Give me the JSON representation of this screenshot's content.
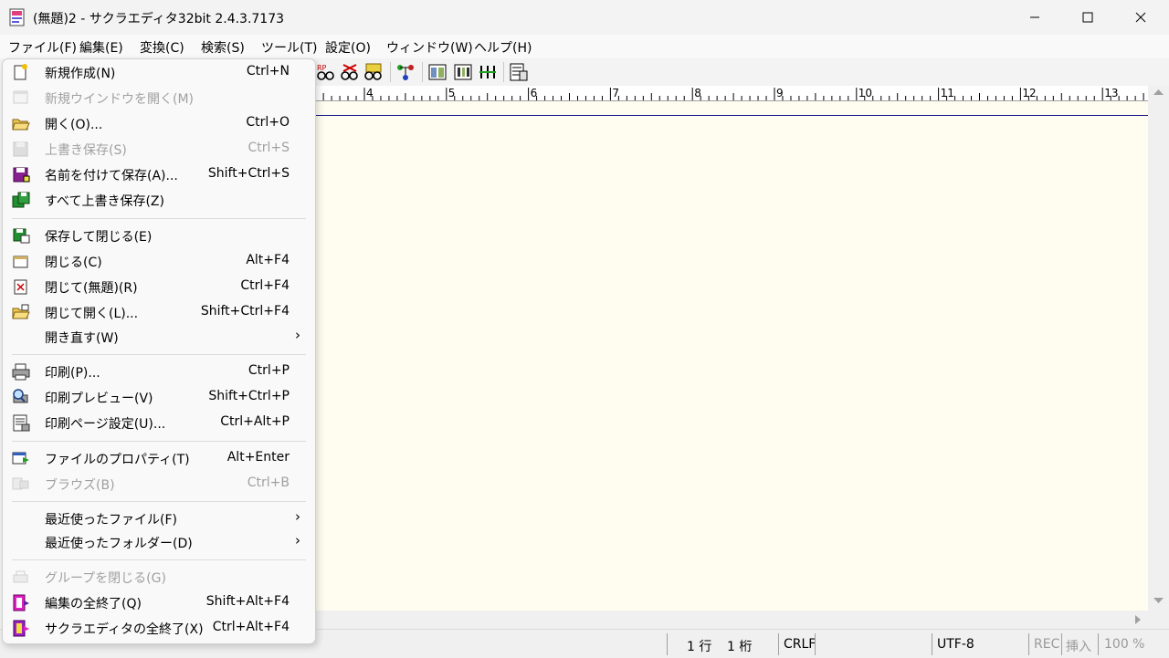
{
  "window": {
    "title": "(無題)2 - サクラエディタ32bit 2.4.3.7173"
  },
  "menubar": {
    "items": [
      "ファイル(F)",
      "編集(E)",
      "変換(C)",
      "検索(S)",
      "ツール(T)",
      "設定(O)",
      "ウィンドウ(W)",
      "ヘルプ(H)"
    ]
  },
  "ruler": {
    "labels": [
      "4",
      "5",
      "6",
      "7",
      "8",
      "9",
      "10",
      "11",
      "12",
      "13"
    ]
  },
  "file_menu": {
    "items": [
      {
        "label": "新規作成(N)",
        "shortcut": "Ctrl+N",
        "icon": "new-document-icon"
      },
      {
        "label": "新規ウインドウを開く(M)",
        "shortcut": "",
        "icon": "new-window-icon",
        "disabled": true
      },
      {
        "label": "開く(O)...",
        "shortcut": "Ctrl+O",
        "icon": "open-folder-icon"
      },
      {
        "label": "上書き保存(S)",
        "shortcut": "Ctrl+S",
        "icon": "save-icon",
        "disabled": true
      },
      {
        "label": "名前を付けて保存(A)...",
        "shortcut": "Shift+Ctrl+S",
        "icon": "save-as-icon"
      },
      {
        "label": "すべて上書き保存(Z)",
        "shortcut": "",
        "icon": "save-all-icon"
      },
      {
        "label": "保存して閉じる(E)",
        "shortcut": "",
        "icon": "save-close-icon"
      },
      {
        "label": "閉じる(C)",
        "shortcut": "Alt+F4",
        "icon": "close-document-icon"
      },
      {
        "label": "閉じて(無題)(R)",
        "shortcut": "Ctrl+F4",
        "icon": "close-untitled-icon"
      },
      {
        "label": "閉じて開く(L)...",
        "shortcut": "Shift+Ctrl+F4",
        "icon": "close-open-icon"
      },
      {
        "label": "開き直す(W)",
        "shortcut": "",
        "submenu": true
      },
      {
        "label": "印刷(P)...",
        "shortcut": "Ctrl+P",
        "icon": "print-icon"
      },
      {
        "label": "印刷プレビュー(V)",
        "shortcut": "Shift+Ctrl+P",
        "icon": "print-preview-icon"
      },
      {
        "label": "印刷ページ設定(U)...",
        "shortcut": "Ctrl+Alt+P",
        "icon": "page-setup-icon"
      },
      {
        "label": "ファイルのプロパティ(T)",
        "shortcut": "Alt+Enter",
        "icon": "file-properties-icon"
      },
      {
        "label": "ブラウズ(B)",
        "shortcut": "Ctrl+B",
        "icon": "browse-icon",
        "disabled": true
      },
      {
        "label": "最近使ったファイル(F)",
        "shortcut": "",
        "submenu": true
      },
      {
        "label": "最近使ったフォルダー(D)",
        "shortcut": "",
        "submenu": true
      },
      {
        "label": "グループを閉じる(G)",
        "shortcut": "",
        "icon": "close-group-icon",
        "disabled": true
      },
      {
        "label": "編集の全終了(Q)",
        "shortcut": "Shift+Alt+F4",
        "icon": "exit-all-edit-icon"
      },
      {
        "label": "サクラエディタの全終了(X)",
        "shortcut": "Ctrl+Alt+F4",
        "icon": "exit-all-sakura-icon"
      }
    ]
  },
  "statusbar": {
    "line": "1 行",
    "col": "1 桁",
    "eol": "CRLF",
    "encoding": "UTF-8",
    "rec": "REC",
    "insert_mode": "挿入",
    "zoom": "100 %"
  },
  "colors": {
    "editor_bg": "#fffcf0",
    "cursor_line": "#1a1a8a",
    "menu_bg": "#f9f9f9"
  }
}
